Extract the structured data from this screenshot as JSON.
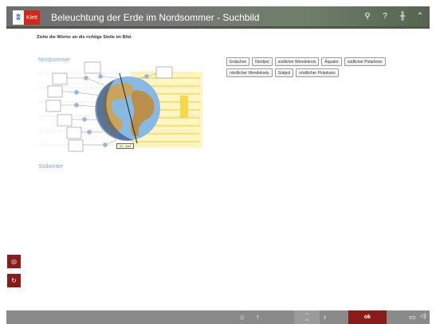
{
  "header": {
    "logo_mark": "ʬ",
    "logo_brand": "Klett",
    "title": "Beleuchtung der Erde im Nordsommer - Suchbild",
    "icons": [
      "search-icon",
      "help-icon",
      "pin-icon",
      "collapse-icon"
    ],
    "icon_glyphs": [
      "⚲",
      "?",
      "╫",
      "⌃"
    ]
  },
  "instruction": "Ziehe die Wörter an die richtige Stelle im Bild.",
  "figure": {
    "label_top": "Nordsommer",
    "label_bottom": "Südwinter",
    "date_tag": "21. Juni"
  },
  "words": [
    "Erdachse",
    "Nordpol",
    "südlicher Wendekreis",
    "Äquator",
    "südlicher Polarkreis",
    "nördlicher Wendekreis",
    "Südpol",
    "nördlicher Polarkreis"
  ],
  "side_tools": {
    "top_glyph": "◎",
    "bottom_glyph": "↻"
  },
  "bottombar": {
    "home_glyph": "⌂",
    "up_glyph": "↑",
    "page_dots": "•••",
    "page_number": "1/1",
    "next_glyph": "›",
    "ok_label": "ok",
    "screen_glyph": "▭",
    "sound_glyph": "◁)"
  },
  "colors": {
    "accent": "#8b1a1a",
    "header_gray": "#707070",
    "sunlight": "#f7d94a",
    "ocean": "#7fb2dd"
  }
}
